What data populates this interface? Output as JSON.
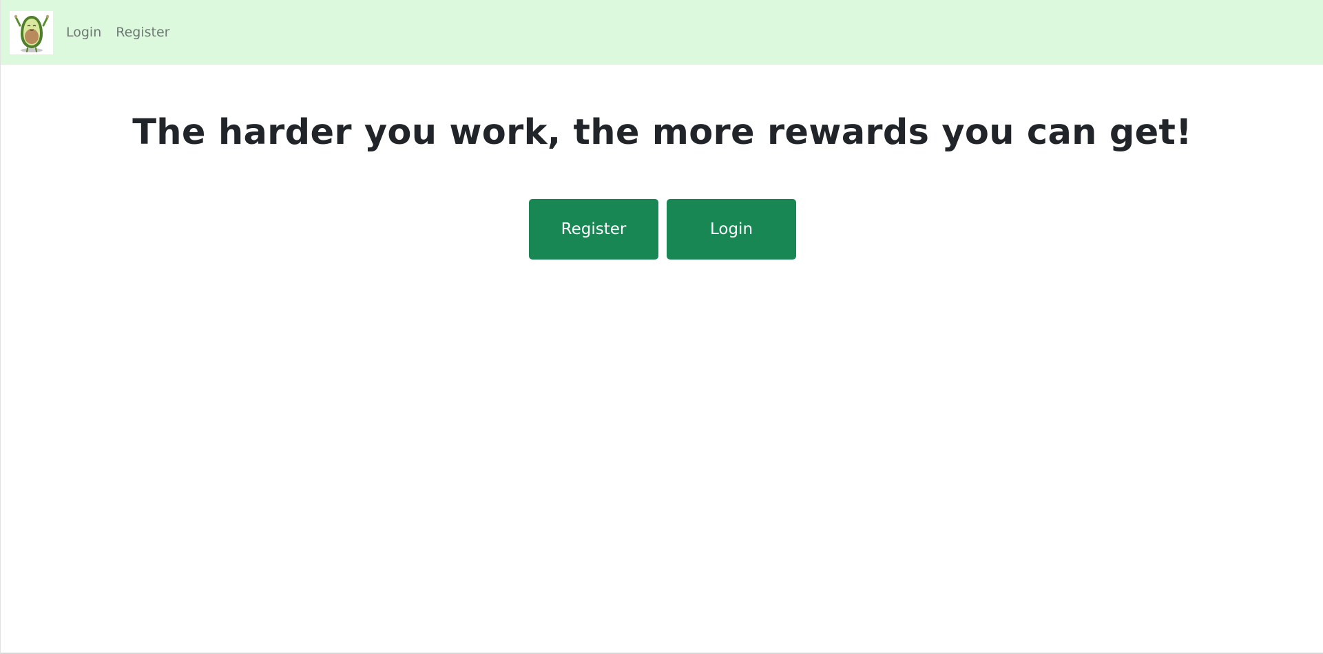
{
  "navbar": {
    "logo_icon": "avocado-mascot-icon",
    "background_color": "#dcf8dd",
    "links": [
      {
        "label": "Login"
      },
      {
        "label": "Register"
      }
    ]
  },
  "hero": {
    "title": "The harder you work, the more rewards you can get!"
  },
  "actions": {
    "register_label": "Register",
    "login_label": "Login",
    "button_color": "#198754"
  }
}
